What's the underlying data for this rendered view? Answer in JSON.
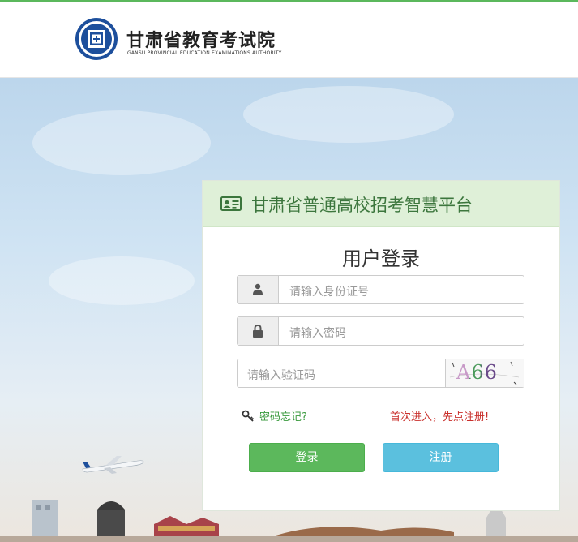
{
  "header": {
    "org_name": "甘肃省教育考试院",
    "org_name_en": "GANSU PROVINCIAL EDUCATION EXAMINATIONS AUTHORITY"
  },
  "panel": {
    "title": "甘肃省普通高校招考智慧平台",
    "login_title": "用户登录",
    "id_placeholder": "请输入身份证号",
    "password_placeholder": "请输入密码",
    "captcha_placeholder": "请输入验证码",
    "captcha_text": "A66",
    "forgot_label": "密码忘记?",
    "first_time_label": "首次进入，先点注册!",
    "login_button": "登录",
    "register_button": "注册"
  },
  "colors": {
    "accent_green": "#5cb85c",
    "accent_blue": "#5bc0de",
    "header_green": "#dff0d8",
    "title_green": "#3c763d",
    "warning_red": "#c9302c"
  },
  "icons": [
    "logo-emblem",
    "id-card-icon",
    "user-icon",
    "lock-icon",
    "key-icon"
  ]
}
